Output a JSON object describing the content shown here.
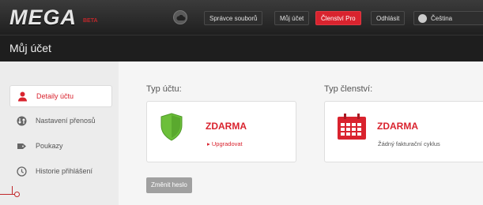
{
  "brand": {
    "logo": "MEGA",
    "beta": "BETA"
  },
  "nav": {
    "file_manager": "Správce souborů",
    "my_account": "Můj účet",
    "pro": "Členství Pro",
    "logout": "Odhlásit",
    "language": "Čeština"
  },
  "page_title": "Můj účet",
  "sidebar": {
    "items": [
      {
        "label": "Detaily účtu",
        "icon": "user-icon",
        "active": true
      },
      {
        "label": "Nastavení přenosů",
        "icon": "transfer-icon",
        "active": false
      },
      {
        "label": "Poukazy",
        "icon": "voucher-icon",
        "active": false
      },
      {
        "label": "Historie přihlášení",
        "icon": "clock-icon",
        "active": false
      }
    ]
  },
  "account": {
    "type_label": "Typ účtu:",
    "type_value": "ZDARMA",
    "upgrade": "Upgradovat",
    "membership_label": "Typ členství:",
    "membership_value": "ZDARMA",
    "billing_cycle": "Žádný fakturační cyklus",
    "change_password": "Změnit heslo"
  },
  "colors": {
    "accent": "#d9232e",
    "shield": "#6cbf3a"
  }
}
